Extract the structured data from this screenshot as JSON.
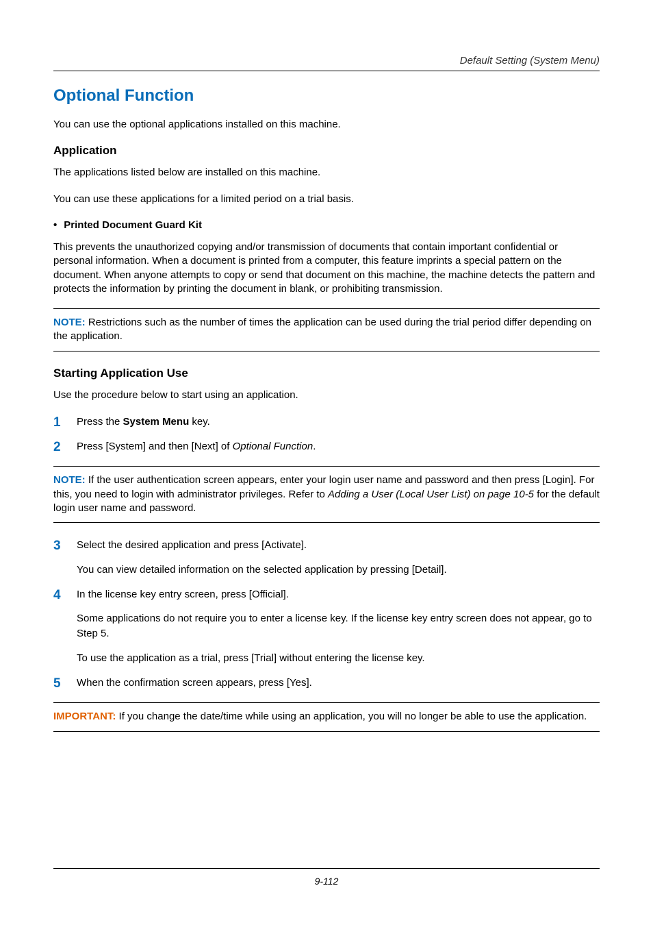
{
  "header": {
    "title": "Default Setting (System Menu)"
  },
  "h1": "Optional Function",
  "intro": "You can use the optional applications installed on this machine.",
  "app": {
    "heading": "Application",
    "p1": "The applications listed below are installed on this machine.",
    "p2": "You can use these applications for a limited period on a trial basis.",
    "bullet": "Printed Document Guard Kit",
    "desc": "This prevents the unauthorized copying and/or transmission of documents that contain important confidential or personal information. When a document is printed from a computer, this feature imprints a special pattern on the document. When anyone attempts to copy or send that document on this machine, the machine detects the pattern and protects the information by printing the document in blank, or prohibiting transmission."
  },
  "note1": {
    "label": "NOTE:",
    "text": " Restrictions such as the number of times the application can be used during the trial period differ depending on the application."
  },
  "start": {
    "heading": "Starting Application Use",
    "intro": "Use the procedure below to start using an application.",
    "step1_a": "Press the ",
    "step1_b": "System Menu",
    "step1_c": " key.",
    "step2_a": "Press [System] and then [Next] of ",
    "step2_b": "Optional Function",
    "step2_c": "."
  },
  "note2": {
    "label": "NOTE:",
    "text_a": " If the user authentication screen appears, enter your login user name and password and then press [Login]. For this, you need to login with administrator privileges. Refer to ",
    "text_b": "Adding a User (Local User List) on page 10-5",
    "text_c": " for the default login user name and password."
  },
  "steps2": {
    "s3_a": "Select the desired application and press [Activate].",
    "s3_b": "You can view detailed information on the selected application by pressing [Detail].",
    "s4_a": "In the license key entry screen, press [Official].",
    "s4_b": "Some applications do not require you to enter a license key. If the license key entry screen does not appear, go to Step 5.",
    "s4_c": "To use the application as a trial, press [Trial] without entering the license key.",
    "s5": "When the confirmation screen appears, press [Yes]."
  },
  "important": {
    "label": "IMPORTANT:",
    "text": " If you change the date/time while using an application, you will no longer be able to use the application."
  },
  "footer": {
    "page": "9-112"
  }
}
